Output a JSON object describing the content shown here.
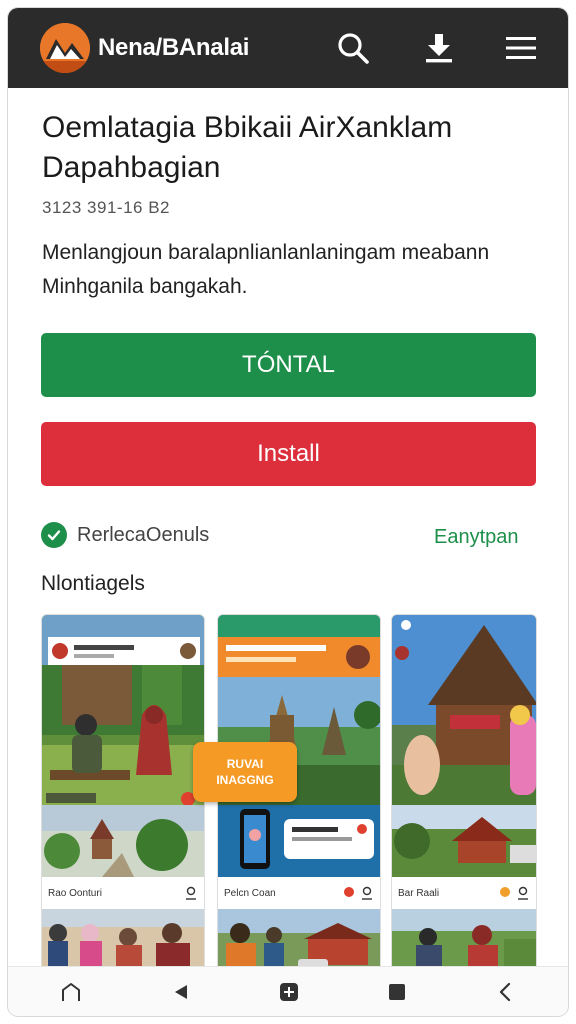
{
  "app": {
    "brand": "Nena/BAnalai",
    "icons": {
      "search": "search-icon",
      "download": "download-icon",
      "menu": "menu-icon"
    }
  },
  "page": {
    "title": "Oemlatagia Bbikaii AirXanklam Dapahbagian",
    "meta": "3123 391-16 B2",
    "description": "Menlangjoun baralapnlianlanlaningam meabann Minhganila bangakah."
  },
  "buttons": {
    "primary_label": "TÓNTAL",
    "install_label": "Install"
  },
  "verified": {
    "label": "RerlecaOenuls",
    "link_label": "Eanytpan"
  },
  "screenshots": {
    "title": "Nlontiagels",
    "banner_line1": "RUVAI",
    "banner_line2": "INAGGNG",
    "items": [
      {
        "caption": "Rao Oonturi"
      },
      {
        "caption": "Pelcn Coan"
      },
      {
        "caption": "Bar Raali"
      }
    ]
  },
  "colors": {
    "appbar": "#2b2b2b",
    "primary_green": "#1e8f4a",
    "install_red": "#dd2e3c",
    "banner_orange": "#f59a25"
  },
  "navbar": {
    "items": [
      "home-icon",
      "back-icon",
      "app-switch-icon",
      "square-icon",
      "chevron-left-icon"
    ]
  }
}
